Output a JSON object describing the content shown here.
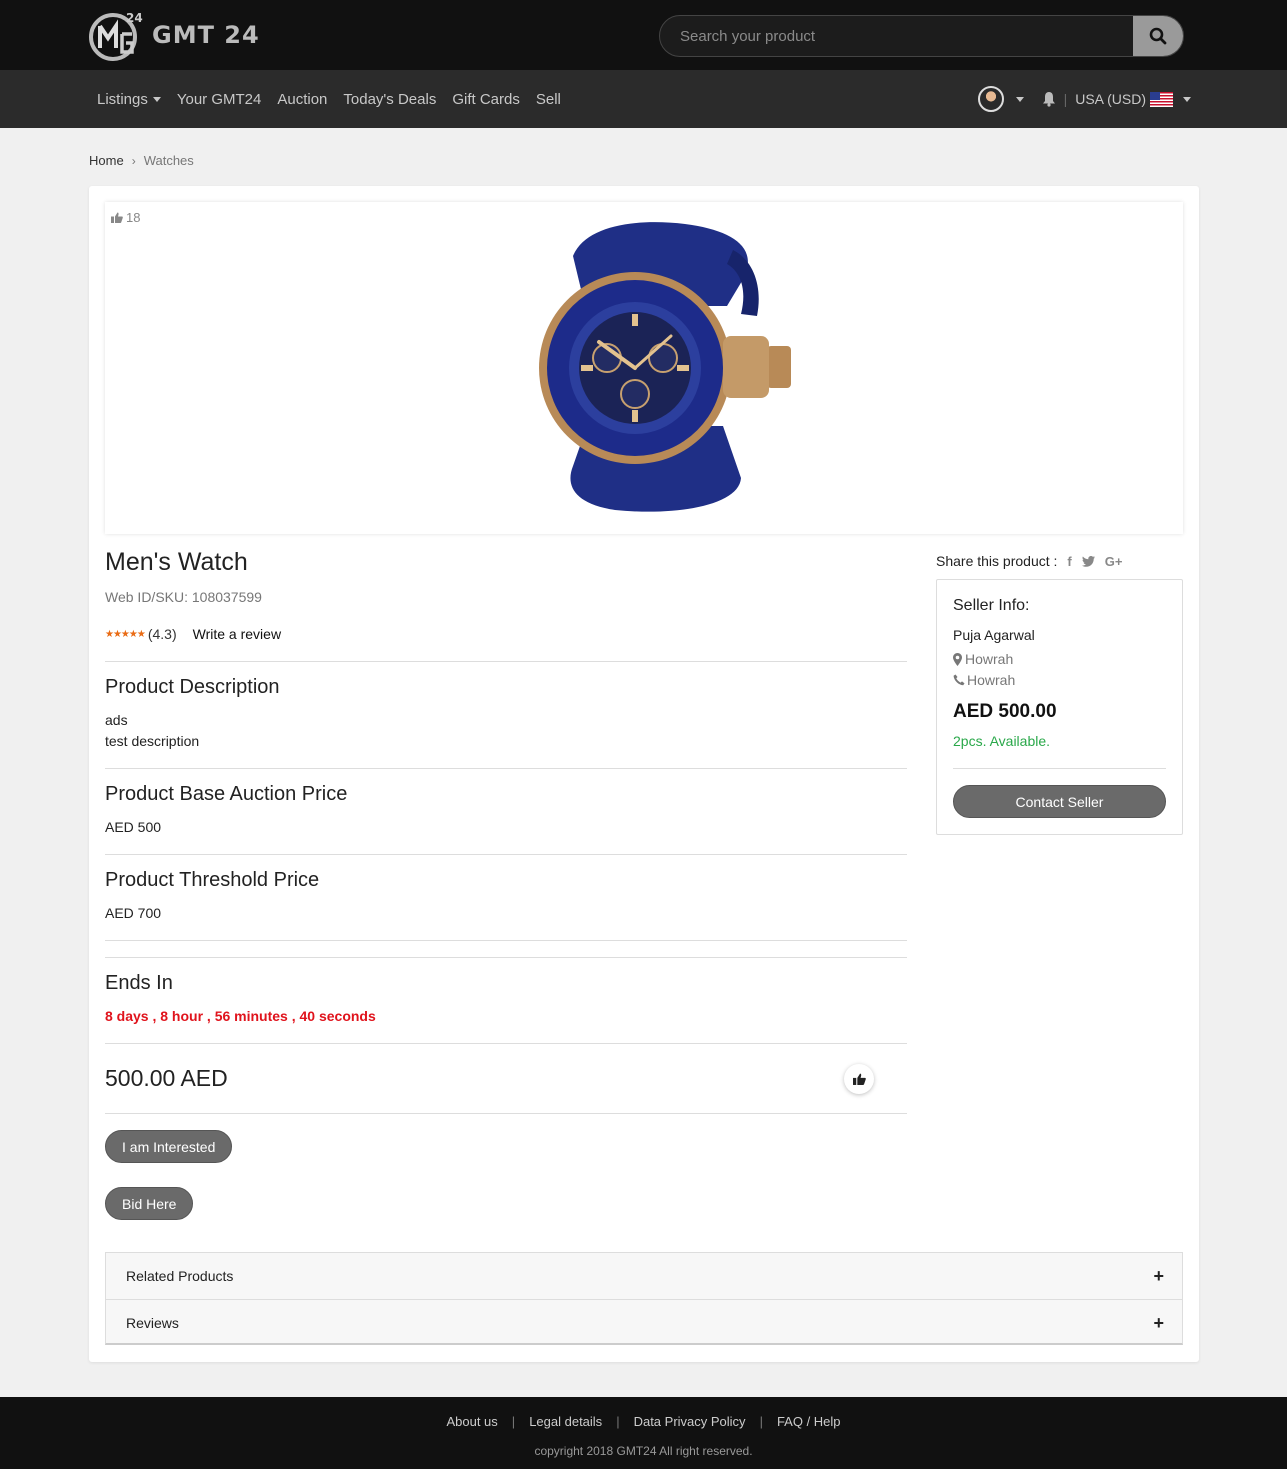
{
  "header": {
    "brand": "GMT 24",
    "search_placeholder": "Search your product"
  },
  "nav": {
    "items": [
      {
        "label": "Listings",
        "dropdown": true
      },
      {
        "label": "Your GMT24"
      },
      {
        "label": "Auction"
      },
      {
        "label": "Today's Deals"
      },
      {
        "label": "Gift Cards"
      },
      {
        "label": "Sell"
      }
    ],
    "currency": "USA (USD)"
  },
  "breadcrumb": [
    "Home",
    "Watches"
  ],
  "product": {
    "likes": "18",
    "title": "Men's Watch",
    "sku": "Web ID/SKU: 108037599",
    "rating": "(4.3)",
    "write_review": "Write a review",
    "description_title": "Product Description",
    "description_lines": [
      "ads",
      "test description"
    ],
    "base_price_title": "Product Base Auction Price",
    "base_price": "AED 500",
    "threshold_title": "Product Threshold Price",
    "threshold_price": "AED 700",
    "ends_title": "Ends In",
    "countdown": "8 days , 8 hour , 56 minutes , 40 seconds",
    "current_price": "500.00 AED",
    "interested_label": "I am Interested",
    "bid_label": "Bid Here"
  },
  "share": {
    "label": "Share this product :",
    "icons": [
      "facebook-icon",
      "twitter-icon",
      "google-plus-icon"
    ]
  },
  "seller": {
    "label": "Seller Info:",
    "name": "Puja Agarwal",
    "location": "Howrah",
    "phone": "Howrah",
    "price": "AED 500.00",
    "availability": "2pcs. Available.",
    "contact_label": "Contact Seller"
  },
  "accordion": [
    "Related Products",
    "Reviews"
  ],
  "footer": {
    "links": [
      "About us",
      "Legal details",
      "Data Privacy Policy",
      "FAQ / Help"
    ],
    "copyright": "copyright 2018 GMT24 All right reserved."
  },
  "colors": {
    "header_bg": "#111111",
    "nav_bg": "#2b2b2b",
    "button_bg": "#6a6a6a",
    "countdown": "#e0131c",
    "available": "#2aa84a",
    "stars": "#e96b14"
  }
}
